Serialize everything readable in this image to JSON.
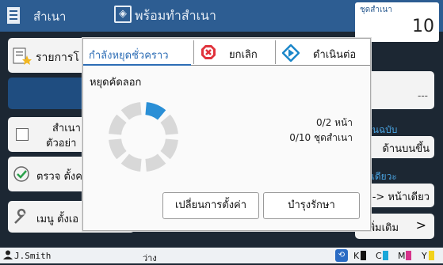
{
  "header": {
    "app_title": "สำเนา",
    "ready_text": "พร้อมทำสำเนา",
    "copies_label": "ชุดสำเนา",
    "copies_value": "10"
  },
  "left_panel": {
    "item1": "รายการโ",
    "item3_line1": "สำเนา",
    "item3_line2": "ตัวอย่า",
    "item4": "ตรวจ ตั้งค",
    "item5": "เมนู ตั้งเอ"
  },
  "right_panel": {
    "r1_value": "---",
    "r2_label": "ต้นฉบับ",
    "r2_value": "ด้านบนขึ้น",
    "r3_label": "าเดียวะ",
    "r3_value": "-> หน้าเดียว",
    "r4_value": "เพิ่มเติม",
    "r4_arrow": ">"
  },
  "dialog": {
    "title": "กำลังหยุดชั่วคราว",
    "cancel_label": "ยกเลิก",
    "continue_label": "ดำเนินต่อ",
    "message": "หยุดคัดลอก",
    "pages": "0/2 หน้า",
    "sets": "0/10 ชุดสำเนา",
    "change_settings": "เปลี่ยนการตั้งค่า",
    "maintenance": "บำรุงรักษา"
  },
  "status_bar": {
    "user": "J.Smith",
    "status": "ว่าง",
    "inks": [
      {
        "label": "K",
        "color": "#111111"
      },
      {
        "label": "C",
        "color": "#19a7d9"
      },
      {
        "label": "M",
        "color": "#d6348c"
      },
      {
        "label": "Y",
        "color": "#f2d21b"
      }
    ]
  },
  "colors": {
    "accent": "#2d5d92",
    "cancel_red": "#e0323b",
    "continue_blue": "#1a86c9",
    "spinner_active": "#2a8fd6",
    "spinner_idle": "#d8d8d8"
  },
  "icons": {
    "app": "document-icon",
    "ready": "diamond-arrow-icon",
    "cancel": "stop-icon",
    "continue": "play-diamond-icon",
    "user": "user-icon",
    "network": "network-icon",
    "check": "checkmark-circle-icon",
    "wrench": "wrench-icon",
    "list": "list-star-icon"
  }
}
